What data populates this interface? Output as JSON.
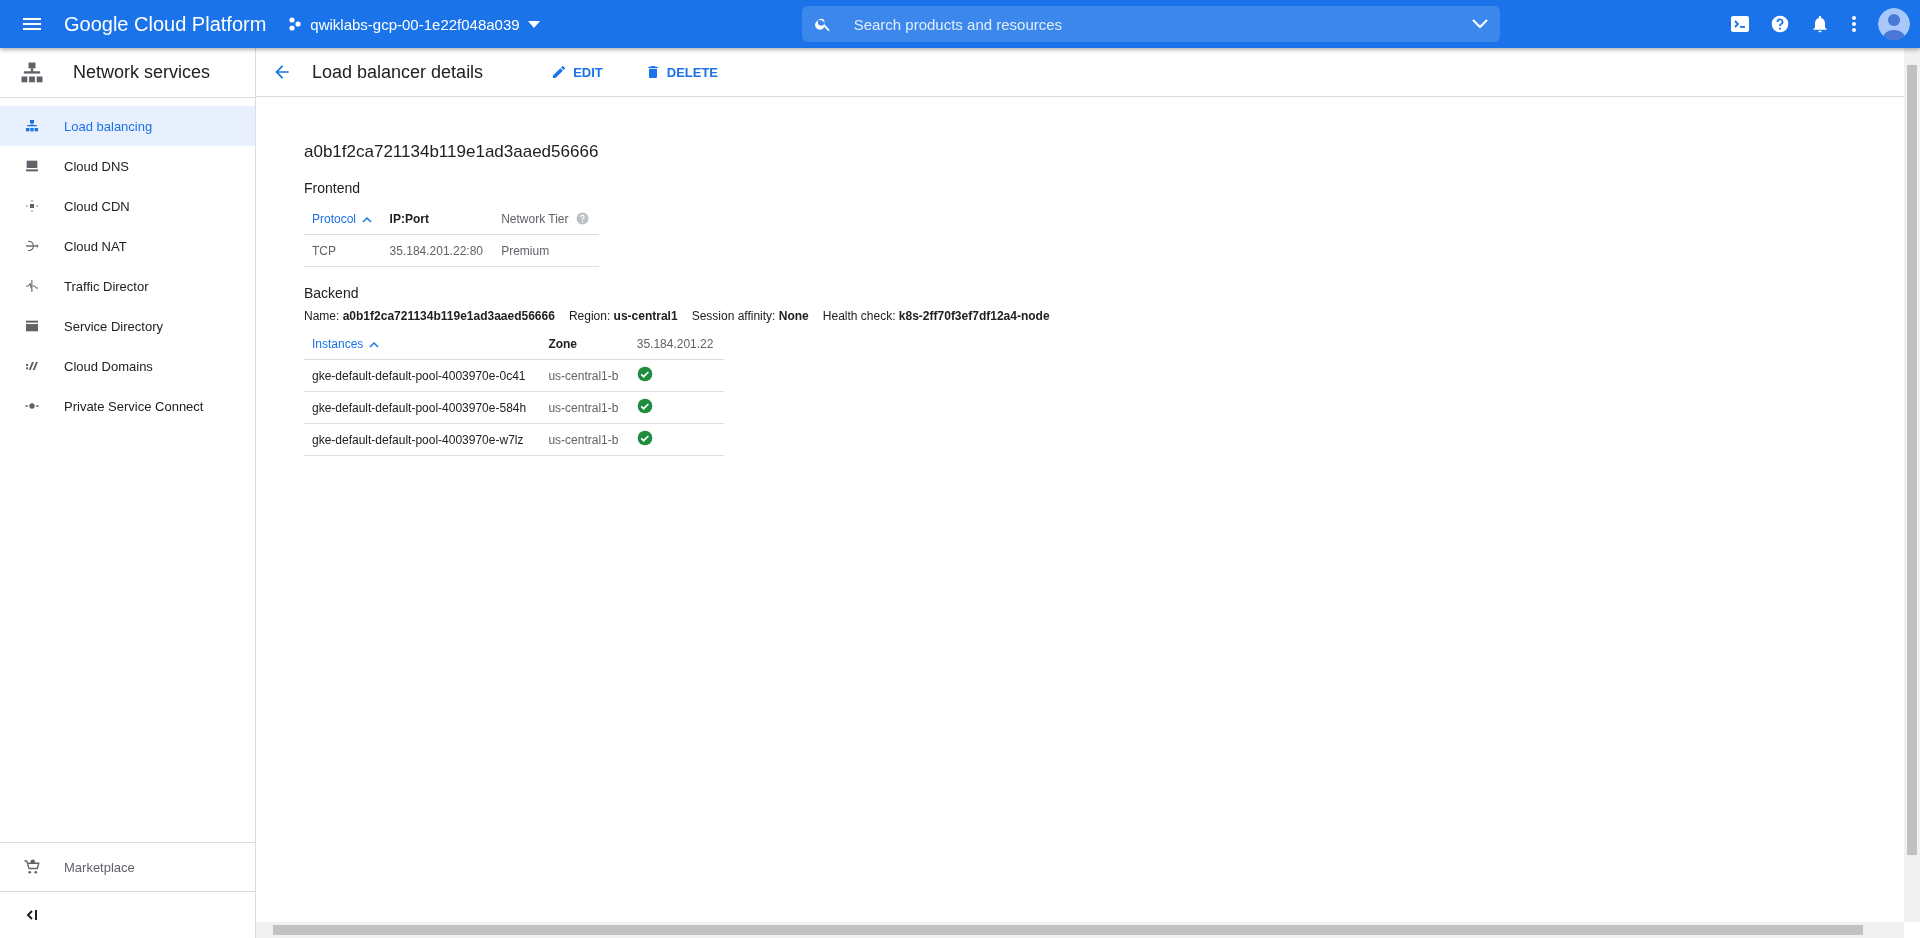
{
  "topbar": {
    "brand": "Google Cloud Platform",
    "project": "qwiklabs-gcp-00-1e22f048a039",
    "search": {
      "placeholder": "Search products and resources"
    }
  },
  "sidebar": {
    "title": "Network services",
    "items": [
      {
        "label": "Load balancing",
        "selected": true
      },
      {
        "label": "Cloud DNS",
        "selected": false
      },
      {
        "label": "Cloud CDN",
        "selected": false
      },
      {
        "label": "Cloud NAT",
        "selected": false
      },
      {
        "label": "Traffic Director",
        "selected": false
      },
      {
        "label": "Service Directory",
        "selected": false
      },
      {
        "label": "Cloud Domains",
        "selected": false
      },
      {
        "label": "Private Service Connect",
        "selected": false
      }
    ],
    "footer_item": "Marketplace"
  },
  "header": {
    "title": "Load balancer details",
    "actions": [
      {
        "kind": "edit",
        "label": "EDIT"
      },
      {
        "kind": "delete",
        "label": "DELETE"
      }
    ]
  },
  "detail": {
    "name": "a0b1f2ca721134b119e1ad3aaed56666",
    "frontend": {
      "title": "Frontend",
      "columns": [
        {
          "label": "Protocol",
          "sorted": true,
          "help": false
        },
        {
          "label": "IP:Port",
          "sorted": false,
          "help": false
        },
        {
          "label": "Network Tier",
          "sorted": false,
          "help": true
        }
      ],
      "rows": [
        [
          "TCP",
          "35.184.201.22:80",
          "Premium"
        ]
      ]
    },
    "backend": {
      "title": "Backend",
      "info": [
        {
          "label": "Name:",
          "value": "a0b1f2ca721134b119e1ad3aaed56666"
        },
        {
          "label": "Region:",
          "value": "us-central1"
        },
        {
          "label": "Session affinity:",
          "value": "None"
        },
        {
          "label": "Health check:",
          "value": "k8s-2ff70f3ef7df12a4-node"
        }
      ],
      "columns": [
        {
          "label": "Instances",
          "sorted": true
        },
        {
          "label": "Zone",
          "sorted": false
        },
        {
          "label": "35.184.201.22",
          "sorted": false
        }
      ],
      "rows": [
        {
          "instance": "gke-default-default-pool-4003970e-0c41",
          "zone": "us-central1-b",
          "healthy": true
        },
        {
          "instance": "gke-default-default-pool-4003970e-584h",
          "zone": "us-central1-b",
          "healthy": true
        },
        {
          "instance": "gke-default-default-pool-4003970e-w7lz",
          "zone": "us-central1-b",
          "healthy": true
        }
      ]
    }
  }
}
